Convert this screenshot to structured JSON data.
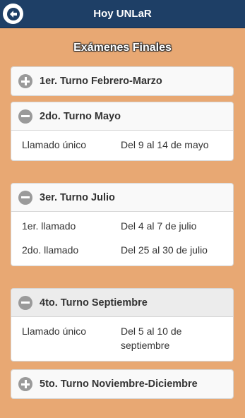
{
  "header": {
    "title": "Hoy UNLaR",
    "background": "#1e3f66"
  },
  "page": {
    "title": "Exámenes Finales",
    "background": "#e8a873"
  },
  "turnos": [
    {
      "title": "1er. Turno Febrero-Marzo",
      "expanded": false,
      "rows": []
    },
    {
      "title": "2do. Turno Mayo",
      "expanded": true,
      "rows": [
        {
          "label": "Llamado único",
          "value": "Del 9 al 14 de mayo"
        }
      ]
    },
    {
      "title": "3er. Turno Julio",
      "expanded": true,
      "rows": [
        {
          "label": "1er. llamado",
          "value": "Del 4 al 7 de julio"
        },
        {
          "label": "2do. llamado",
          "value": "Del 25 al 30 de julio"
        }
      ]
    },
    {
      "title": "4to. Turno Septiembre",
      "expanded": true,
      "rows": [
        {
          "label": "Llamado único",
          "value": "Del 5 al 10 de septiembre"
        }
      ]
    },
    {
      "title": "5to. Turno Noviembre-Diciembre",
      "expanded": false,
      "rows": []
    }
  ]
}
